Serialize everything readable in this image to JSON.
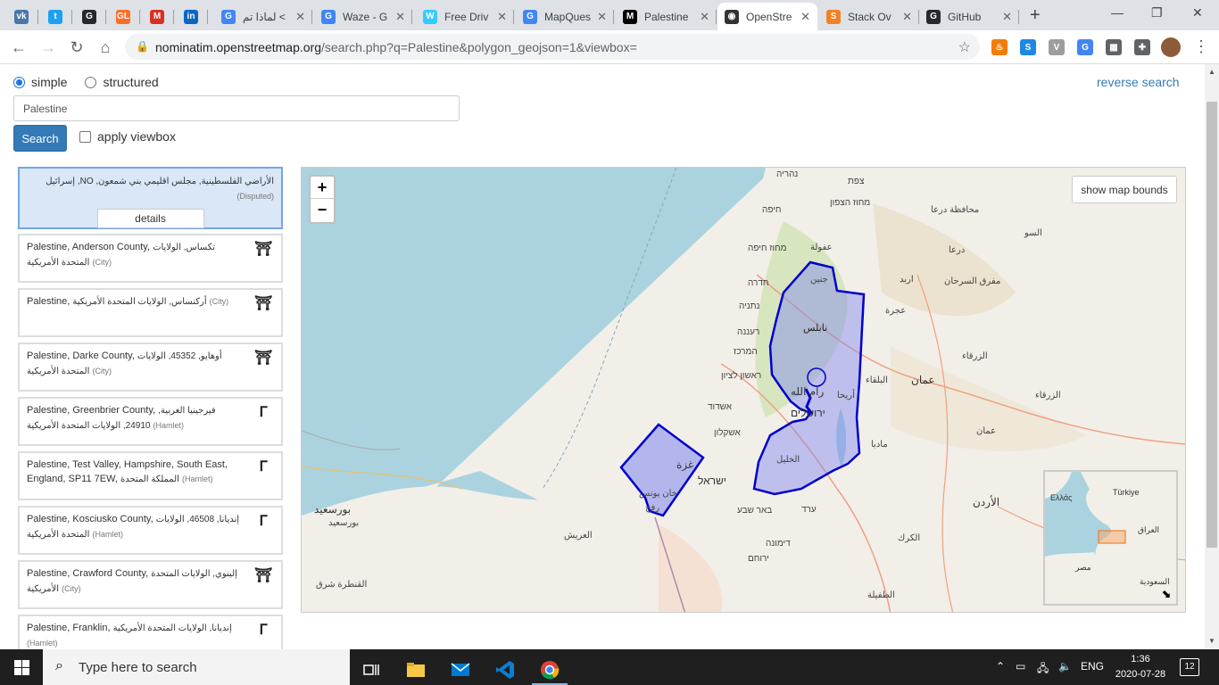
{
  "browser": {
    "tabs": [
      {
        "title": "",
        "icon": "vk-icon",
        "color": "#4a76a8",
        "glyph": "vk"
      },
      {
        "title": "",
        "icon": "twitter-icon",
        "color": "#1da1f2",
        "glyph": "t"
      },
      {
        "title": "",
        "icon": "github-icon",
        "color": "#24292e",
        "glyph": "G"
      },
      {
        "title": "",
        "icon": "gitlab-icon",
        "color": "#fc6d26",
        "glyph": "GL"
      },
      {
        "title": "",
        "icon": "gmail-icon",
        "color": "#d93025",
        "glyph": "M"
      },
      {
        "title": "",
        "icon": "linkedin-icon",
        "color": "#0a66c2",
        "glyph": "in"
      },
      {
        "title": "لماذا تم <",
        "icon": "google-icon",
        "color": "#4285f4",
        "glyph": "G"
      },
      {
        "title": "Waze - G",
        "icon": "google-icon",
        "color": "#4285f4",
        "glyph": "G"
      },
      {
        "title": "Free Driv",
        "icon": "waze-icon",
        "color": "#33ccff",
        "glyph": "W"
      },
      {
        "title": "MapQues",
        "icon": "google-icon",
        "color": "#4285f4",
        "glyph": "G"
      },
      {
        "title": "Palestine",
        "icon": "medium-icon",
        "color": "#000000",
        "glyph": "M"
      },
      {
        "title": "OpenStre",
        "icon": "globe-icon",
        "color": "#333333",
        "glyph": "◉"
      },
      {
        "title": "Stack Ov",
        "icon": "stackoverflow-icon",
        "color": "#f48024",
        "glyph": "S"
      },
      {
        "title": "GitHub",
        "icon": "github-icon",
        "color": "#24292e",
        "glyph": "G"
      }
    ],
    "active_tab_index": 11,
    "url_host": "nominatim.openstreetmap.org",
    "url_path": "/search.php?q=Palestine&polygon_geojson=1&viewbox="
  },
  "form": {
    "mode_simple": "simple",
    "mode_structured": "structured",
    "reverse_search": "reverse search",
    "query_value": "Palestine",
    "search_button": "Search",
    "apply_viewbox": "apply viewbox"
  },
  "results": [
    {
      "name": "",
      "arabic": "إسرائيل ,NO ,الأراضي الفلسطينية, مجلس اقليمي بني شمعون",
      "type": "(Disputed)",
      "icon": "",
      "details": "details"
    },
    {
      "name": "Palestine, Anderson County, ",
      "arabic": "تكساس, الولايات المتحدة الأمريكية",
      "type": "(City)",
      "icon": "city-icon"
    },
    {
      "name": "Palestine, ",
      "arabic": "أركنساس, الولايات المتحدة الأمريكية",
      "type": "(City)",
      "icon": "city-icon"
    },
    {
      "name": "Palestine, Darke County, ",
      "arabic": "أوهايو, 45352, الولايات المتحدة الأمريكية",
      "type": "(City)",
      "icon": "city-icon"
    },
    {
      "name": "Palestine, Greenbrier County, ",
      "arabic": "فيرجينيا الغربية, 24910, الولايات المتحدة الأمريكية",
      "type": "(Hamlet)",
      "icon": "hamlet-icon"
    },
    {
      "name": "Palestine, Test Valley, Hampshire, South East, England, SP11 7EW, ",
      "arabic": "المملكة المتحدة",
      "type": "(Hamlet)",
      "icon": "hamlet-icon"
    },
    {
      "name": "Palestine, Kosciusko County, ",
      "arabic": "إنديانا, 46508, الولايات المتحدة الأمريكية",
      "type": "(Hamlet)",
      "icon": "hamlet-icon"
    },
    {
      "name": "Palestine, Crawford County, ",
      "arabic": "إلينوي, الولايات المتحدة الأمريكية",
      "type": "(City)",
      "icon": "city-icon"
    },
    {
      "name": "Palestine, Franklin, ",
      "arabic": "إنديانا, الولايات المتحدة الأمريكية",
      "type": "(Hamlet)",
      "icon": "hamlet-icon"
    }
  ],
  "map": {
    "zoom_in": "+",
    "zoom_out": "−",
    "show_bounds": "show map bounds",
    "labels": [
      {
        "text": "נהריה"
      },
      {
        "text": "צפת"
      },
      {
        "text": "חיפה"
      },
      {
        "text": "מחוז הצפון"
      },
      {
        "text": "محافظة درعا"
      },
      {
        "text": "السو"
      },
      {
        "text": "מחוז חיפה"
      },
      {
        "text": "عفولة"
      },
      {
        "text": "جنين"
      },
      {
        "text": "درعا"
      },
      {
        "text": "חדרה"
      },
      {
        "text": "اربد"
      },
      {
        "text": "مفرق السرحان"
      },
      {
        "text": "נתניה"
      },
      {
        "text": "عجرة"
      },
      {
        "text": "نابلس"
      },
      {
        "text": "רעננה"
      },
      {
        "text": "המרכז"
      },
      {
        "text": "الزرقاء"
      },
      {
        "text": "ראשון לציון"
      },
      {
        "text": "رام الله"
      },
      {
        "text": "أريحا"
      },
      {
        "text": "البلقاء"
      },
      {
        "text": "عمان"
      },
      {
        "text": "אשדוד"
      },
      {
        "text": "ירושלים"
      },
      {
        "text": "الزرقاء"
      },
      {
        "text": "אשקלון"
      },
      {
        "text": "عمان"
      },
      {
        "text": "مادبا"
      },
      {
        "text": "غزة"
      },
      {
        "text": "الخليل"
      },
      {
        "text": "ישראל"
      },
      {
        "text": "خان يونس"
      },
      {
        "text": "رفح"
      },
      {
        "text": "באר שבע"
      },
      {
        "text": "ערד"
      },
      {
        "text": "الأردن"
      },
      {
        "text": "بورسعيد"
      },
      {
        "text": "بورسعيد"
      },
      {
        "text": "العريش"
      },
      {
        "text": "דימונה"
      },
      {
        "text": "الكرك"
      },
      {
        "text": "ירוחם"
      },
      {
        "text": "القنطرة شرق"
      },
      {
        "text": "الطفيلة"
      }
    ],
    "minimap_labels": {
      "greece": "Ελλάς",
      "turkey": "Türkiye",
      "iraq": "العراق",
      "egypt": "مصر",
      "saudi": "السعودية"
    },
    "minimap_toggle": "⬊"
  },
  "taskbar": {
    "search_placeholder": "Type here to search",
    "language": "ENG",
    "time": "1:36",
    "date": "2020-07-28",
    "notifications": "12"
  }
}
